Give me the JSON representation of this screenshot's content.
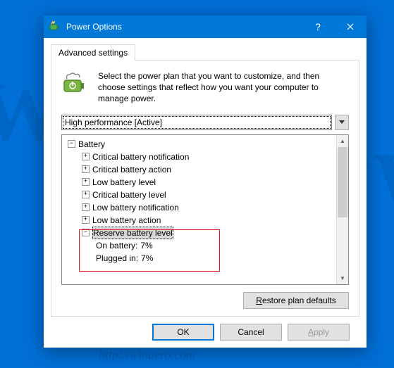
{
  "titlebar": {
    "title": "Power Options"
  },
  "tab": {
    "label": "Advanced settings"
  },
  "intro": {
    "text": "Select the power plan that you want to customize, and then choose settings that reflect how you want your computer to manage power."
  },
  "plan": {
    "selected": "High performance [Active]"
  },
  "tree": {
    "root": "Battery",
    "items": [
      "Critical battery notification",
      "Critical battery action",
      "Low battery level",
      "Critical battery level",
      "Low battery notification",
      "Low battery action"
    ],
    "reserve": {
      "label": "Reserve battery level",
      "on_battery_label": "On battery:",
      "on_battery_value": "7%",
      "plugged_in_label": "Plugged in:",
      "plugged_in_value": "7%"
    }
  },
  "buttons": {
    "restore": "Restore plan defaults",
    "ok": "OK",
    "cancel": "Cancel",
    "apply": "Apply"
  },
  "watermark": {
    "w": "W",
    "url": "http://winaero.com"
  }
}
